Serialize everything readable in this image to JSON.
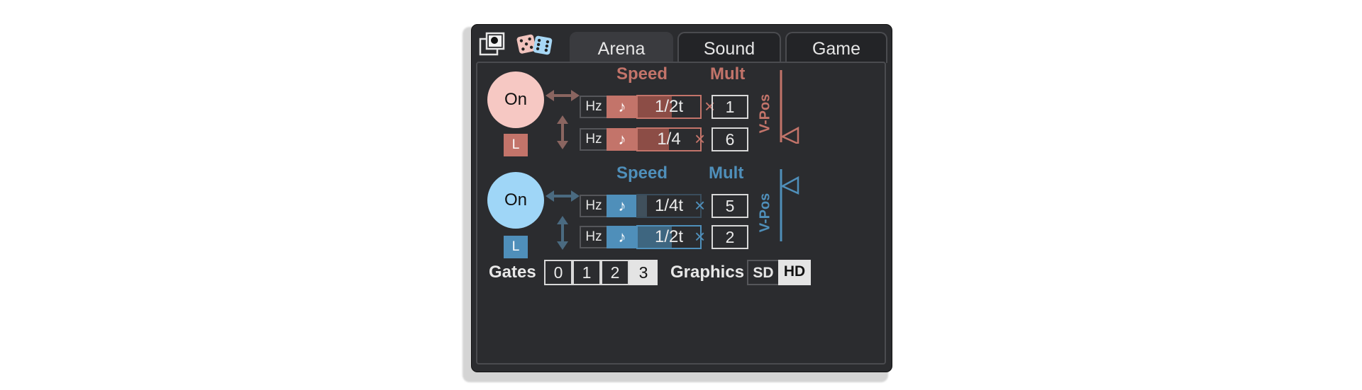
{
  "colors": {
    "red": "#c3746a",
    "red_light": "#f6c8c3",
    "blue": "#4f8fba",
    "blue_light": "#9fd6f7",
    "panel": "#2b2c2f"
  },
  "icons": {
    "window": "window-overlap-icon",
    "dice": "dice-icon",
    "horizontal": "horizontal-arrow-icon",
    "vertical": "vertical-arrow-icon"
  },
  "tabs": [
    {
      "label": "Arena",
      "active": true
    },
    {
      "label": "Sound",
      "active": false
    },
    {
      "label": "Game",
      "active": false
    }
  ],
  "player1": {
    "on_label": "On",
    "l_label": "L",
    "speed_header": "Speed",
    "mult_header": "Mult",
    "vpos_label": "V-Pos",
    "rows": [
      {
        "hz": "Hz",
        "note": "♪",
        "rate": "1/2t",
        "rate_level": 0.55,
        "times": "×",
        "mult": "1"
      },
      {
        "hz": "Hz",
        "note": "♪",
        "rate": "1/4",
        "rate_level": 0.5,
        "times": "×",
        "mult": "6"
      }
    ]
  },
  "player2": {
    "on_label": "On",
    "l_label": "L",
    "speed_header": "Speed",
    "mult_header": "Mult",
    "vpos_label": "V-Pos",
    "rows": [
      {
        "hz": "Hz",
        "note": "♪",
        "rate": "1/4t",
        "rate_level": 0.15,
        "times": "×",
        "mult": "5"
      },
      {
        "hz": "Hz",
        "note": "♪",
        "rate": "1/2t",
        "rate_level": 0.55,
        "times": "×",
        "mult": "2"
      }
    ]
  },
  "gates": {
    "label": "Gates",
    "options": [
      "0",
      "1",
      "2",
      "3"
    ],
    "selected": "3"
  },
  "graphics": {
    "label": "Graphics",
    "options": [
      "SD",
      "HD"
    ],
    "selected": "HD"
  }
}
